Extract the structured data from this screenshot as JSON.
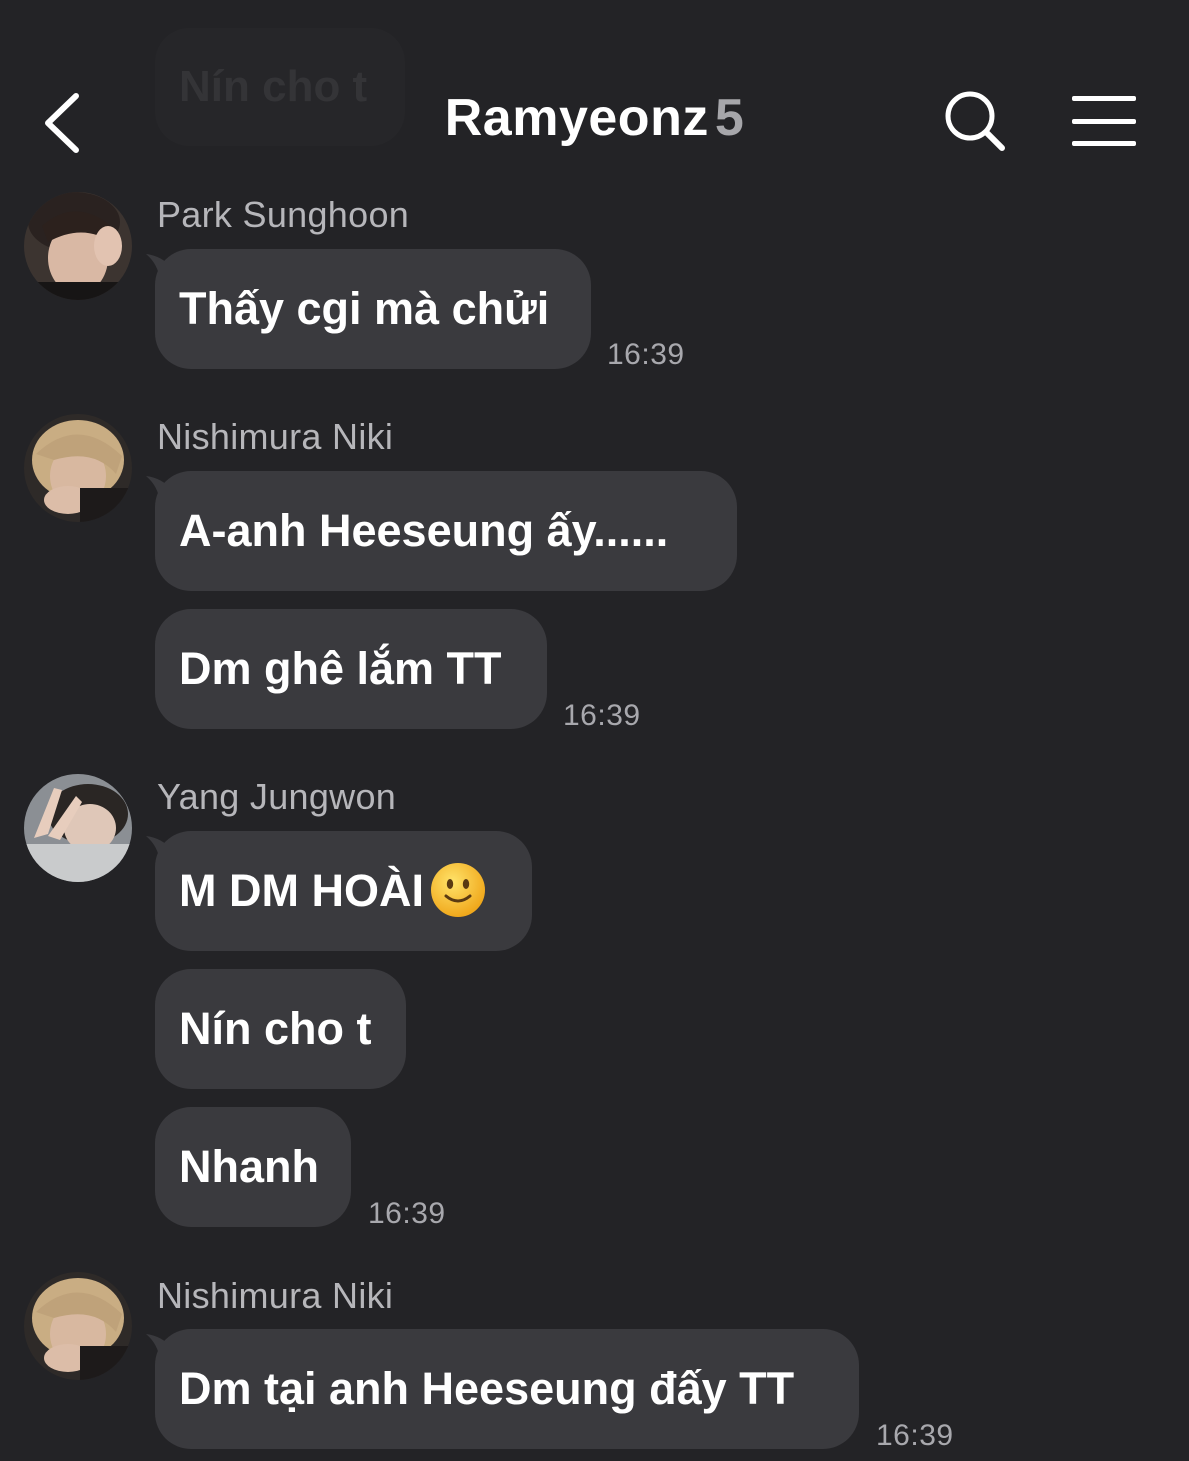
{
  "header": {
    "title": "Ramyeonz",
    "member_count": "5",
    "back_icon": "chevron-left-icon",
    "search_icon": "search-icon",
    "menu_icon": "hamburger-menu-icon"
  },
  "ghost_bubble": {
    "text": "Nín cho t"
  },
  "messages": [
    {
      "sender": "Park Sunghoon",
      "bubbles": [
        "Thấy cgi mà chửi"
      ],
      "time": "16:39"
    },
    {
      "sender": "Nishimura Niki",
      "bubbles": [
        "A-anh Heeseung ấy......",
        "Dm ghê lắm TT"
      ],
      "time": "16:39"
    },
    {
      "sender": "Yang Jungwon",
      "bubbles": [
        "M DM HOÀI",
        "Nín cho t",
        "Nhanh"
      ],
      "emoji": "slightly-smiling-face-emoji",
      "time": "16:39"
    },
    {
      "sender": "Nishimura Niki",
      "bubbles": [
        "Dm tại anh Heeseung đấy TT"
      ],
      "time": "16:39"
    }
  ],
  "colors": {
    "background": "#232326",
    "bubble": "#3a3a3e",
    "sender_text": "#b6b6ba",
    "time_text": "#a8a8ad"
  }
}
